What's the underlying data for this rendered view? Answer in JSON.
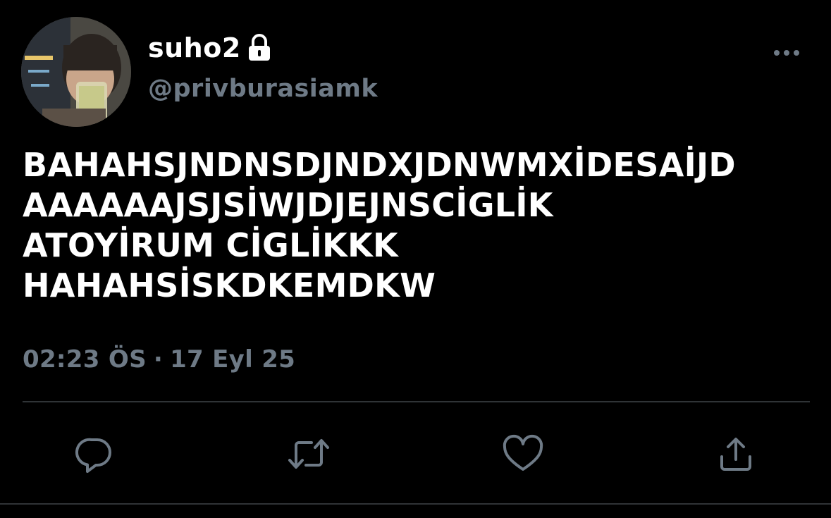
{
  "user": {
    "display_name": "suho2",
    "handle": "@privburasiamk",
    "protected_icon": "lock-icon",
    "avatar_icon": "profile-photo"
  },
  "tweet": {
    "text_lines": [
      "BAHAHSJNDNSDJNDXJDNWMXİDESAİJD",
      "AAAAAAJSJSİWJDJEJNSCİGLİK",
      "ATOYİRUM CİGLİKKK",
      "HAHAHSİSKDKEMDKW"
    ],
    "time": "02:23 ÖS",
    "separator": "·",
    "date": "17 Eyl 25"
  },
  "actions": {
    "reply_icon": "reply-icon",
    "retweet_icon": "retweet-icon",
    "like_icon": "heart-icon",
    "share_icon": "share-icon"
  },
  "menu": {
    "more_icon": "more-icon"
  },
  "colors": {
    "background": "#000000",
    "primary_text": "#ffffff",
    "secondary_text": "#6e7a86",
    "divider": "#2f3336"
  }
}
